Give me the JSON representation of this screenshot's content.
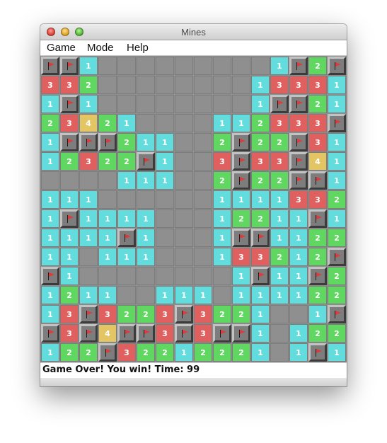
{
  "window": {
    "title": "Mines"
  },
  "menu": {
    "game": "Game",
    "mode": "Mode",
    "help": "Help"
  },
  "status": "Game Over! You win! Time: 99",
  "colors": {
    "one": "#62dcdc",
    "two": "#5fd760",
    "three": "#e05f5f",
    "four": "#e3c564",
    "hidden": "#8f8f8f",
    "flag": "#dd3b3b"
  },
  "legend": {
    "F": "flag-icon",
    "H": "hidden cell",
    "E": "empty revealed cell",
    "1-4": "adjacent mine count"
  },
  "board": [
    [
      "F",
      "F",
      "1",
      "H",
      "H",
      "H",
      "H",
      "H",
      "H",
      "H",
      "H",
      "H",
      "1",
      "F",
      "2",
      "F"
    ],
    [
      "3",
      "3",
      "2",
      "H",
      "H",
      "H",
      "H",
      "H",
      "H",
      "H",
      "H",
      "1",
      "3",
      "3",
      "3",
      "1"
    ],
    [
      "1",
      "F",
      "1",
      "H",
      "H",
      "H",
      "H",
      "H",
      "H",
      "H",
      "H",
      "1",
      "F",
      "F",
      "2",
      "1"
    ],
    [
      "2",
      "3",
      "4",
      "2",
      "1",
      "H",
      "H",
      "H",
      "H",
      "1",
      "1",
      "2",
      "3",
      "3",
      "3",
      "F"
    ],
    [
      "1",
      "F",
      "F",
      "F",
      "2",
      "1",
      "1",
      "H",
      "H",
      "2",
      "F",
      "2",
      "2",
      "F",
      "3",
      "1"
    ],
    [
      "1",
      "2",
      "3",
      "2",
      "2",
      "F",
      "1",
      "H",
      "H",
      "3",
      "F",
      "3",
      "3",
      "F",
      "4",
      "1"
    ],
    [
      "H",
      "H",
      "H",
      "H",
      "1",
      "1",
      "1",
      "H",
      "H",
      "2",
      "F",
      "2",
      "2",
      "F",
      "F",
      "1"
    ],
    [
      "1",
      "1",
      "1",
      "H",
      "H",
      "H",
      "H",
      "H",
      "H",
      "1",
      "1",
      "1",
      "1",
      "3",
      "3",
      "2"
    ],
    [
      "1",
      "F",
      "1",
      "1",
      "1",
      "1",
      "H",
      "H",
      "H",
      "1",
      "2",
      "2",
      "1",
      "1",
      "F",
      "1"
    ],
    [
      "1",
      "1",
      "1",
      "1",
      "F",
      "1",
      "H",
      "H",
      "H",
      "1",
      "F",
      "F",
      "1",
      "1",
      "2",
      "2"
    ],
    [
      "1",
      "1",
      "E",
      "1",
      "1",
      "1",
      "H",
      "H",
      "H",
      "1",
      "3",
      "3",
      "2",
      "1",
      "2",
      "F"
    ],
    [
      "F",
      "1",
      "H",
      "H",
      "H",
      "H",
      "H",
      "H",
      "H",
      "H",
      "1",
      "F",
      "1",
      "1",
      "F",
      "2"
    ],
    [
      "1",
      "2",
      "1",
      "1",
      "H",
      "H",
      "1",
      "1",
      "1",
      "H",
      "1",
      "1",
      "1",
      "1",
      "2",
      "2"
    ],
    [
      "1",
      "3",
      "F",
      "3",
      "2",
      "2",
      "3",
      "F",
      "3",
      "2",
      "2",
      "1",
      "H",
      "H",
      "1",
      "F"
    ],
    [
      "F",
      "3",
      "F",
      "4",
      "F",
      "F",
      "3",
      "F",
      "3",
      "F",
      "F",
      "1",
      "H",
      "1",
      "2",
      "2"
    ],
    [
      "1",
      "2",
      "2",
      "F",
      "3",
      "2",
      "2",
      "1",
      "2",
      "2",
      "2",
      "1",
      "H",
      "1",
      "F",
      "1"
    ]
  ]
}
